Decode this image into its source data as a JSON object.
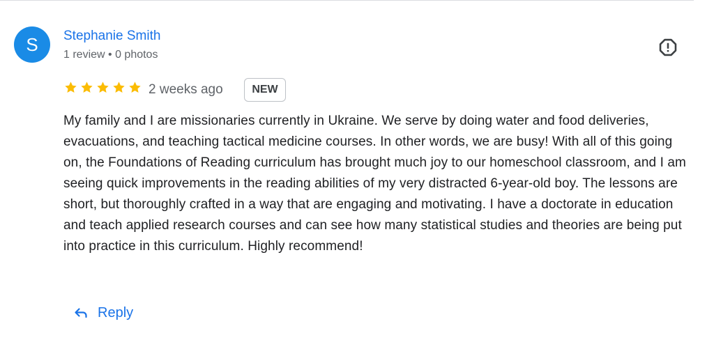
{
  "review": {
    "avatar_letter": "S",
    "avatar_color": "#1a8be6",
    "reviewer_name": "Stephanie Smith",
    "reviewer_meta": "1 review • 0 photos",
    "rating": 5,
    "max_rating": 5,
    "star_color": "#fbbc04",
    "time_ago": "2 weeks ago",
    "badge": "NEW",
    "text": "My family and I are missionaries currently in Ukraine. We serve by doing water and food deliveries, evacuations, and teaching tactical medicine courses. In other words, we are busy! With all of this going on, the Foundations of Reading curriculum has brought much joy to our homeschool classroom, and I am seeing quick improvements in the reading abilities of my very distracted 6-year-old boy. The lessons are short, but thoroughly crafted in a way that are engaging and motivating. I have a doctorate in education and teach applied research courses and can see how many statistical studies and theories are being put into practice in this curriculum. Highly recommend!",
    "report_icon": "report-icon",
    "reply_icon": "reply-arrow-icon",
    "reply_label": "Reply",
    "accent_color": "#1a73e8"
  }
}
